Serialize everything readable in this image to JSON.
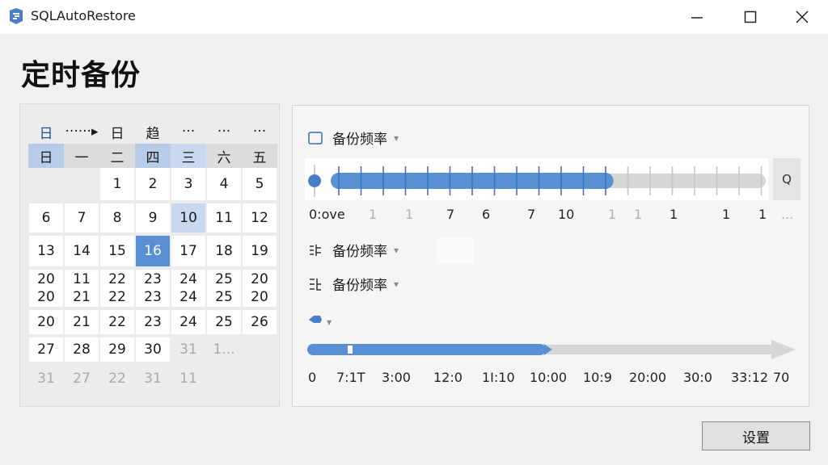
{
  "window": {
    "title": "SQLAutoRestore"
  },
  "page": {
    "title": "定时备份"
  },
  "calendar": {
    "top_header": [
      "日",
      "······▸",
      "日",
      "趋",
      "···",
      "···",
      "···"
    ],
    "weekday_header": [
      "日",
      "一",
      "二",
      "四",
      "三",
      "六",
      "五"
    ],
    "rows": [
      [
        "",
        "",
        "1",
        "2",
        "3",
        "4",
        "5"
      ],
      [
        "6",
        "7",
        "8",
        "9",
        "10",
        "11",
        "12"
      ],
      [
        "13",
        "14",
        "15",
        "16",
        "17",
        "18",
        "19"
      ],
      [
        "20\n20",
        "11\n21",
        "22\n22",
        "23\n23",
        "24\n24",
        "25\n25",
        "20\n20"
      ],
      [
        "20",
        "21",
        "22",
        "23",
        "24",
        "25",
        "26"
      ],
      [
        "27",
        "28",
        "29",
        "30",
        "31",
        "1...",
        ""
      ],
      [
        "31",
        "27",
        "22",
        "31",
        "11",
        "",
        ""
      ]
    ]
  },
  "schedule": {
    "freq_label_1": "备份频率",
    "freq_label_2": "备份频率",
    "freq_label_3": "备份频率",
    "slider1_fill": 0.65,
    "slider1_ticks": [
      "0:ove",
      "1",
      "1",
      "7",
      "6",
      "7",
      "10",
      "1",
      "1",
      "1",
      "1",
      "1",
      "..."
    ],
    "search_button": "Q",
    "slider2_fill": 0.51,
    "slider2_ticks": [
      "0",
      "7:1T",
      "3:00",
      "12:0",
      "1Ι:10",
      "10:00",
      "10:9",
      "20:00",
      "30:0",
      "33:12",
      "70"
    ]
  },
  "footer": {
    "set_button": "设置"
  },
  "colors": {
    "accent": "#5b8fd4",
    "accent_light": "#c7d8ef",
    "track": "#d6d6d6"
  }
}
